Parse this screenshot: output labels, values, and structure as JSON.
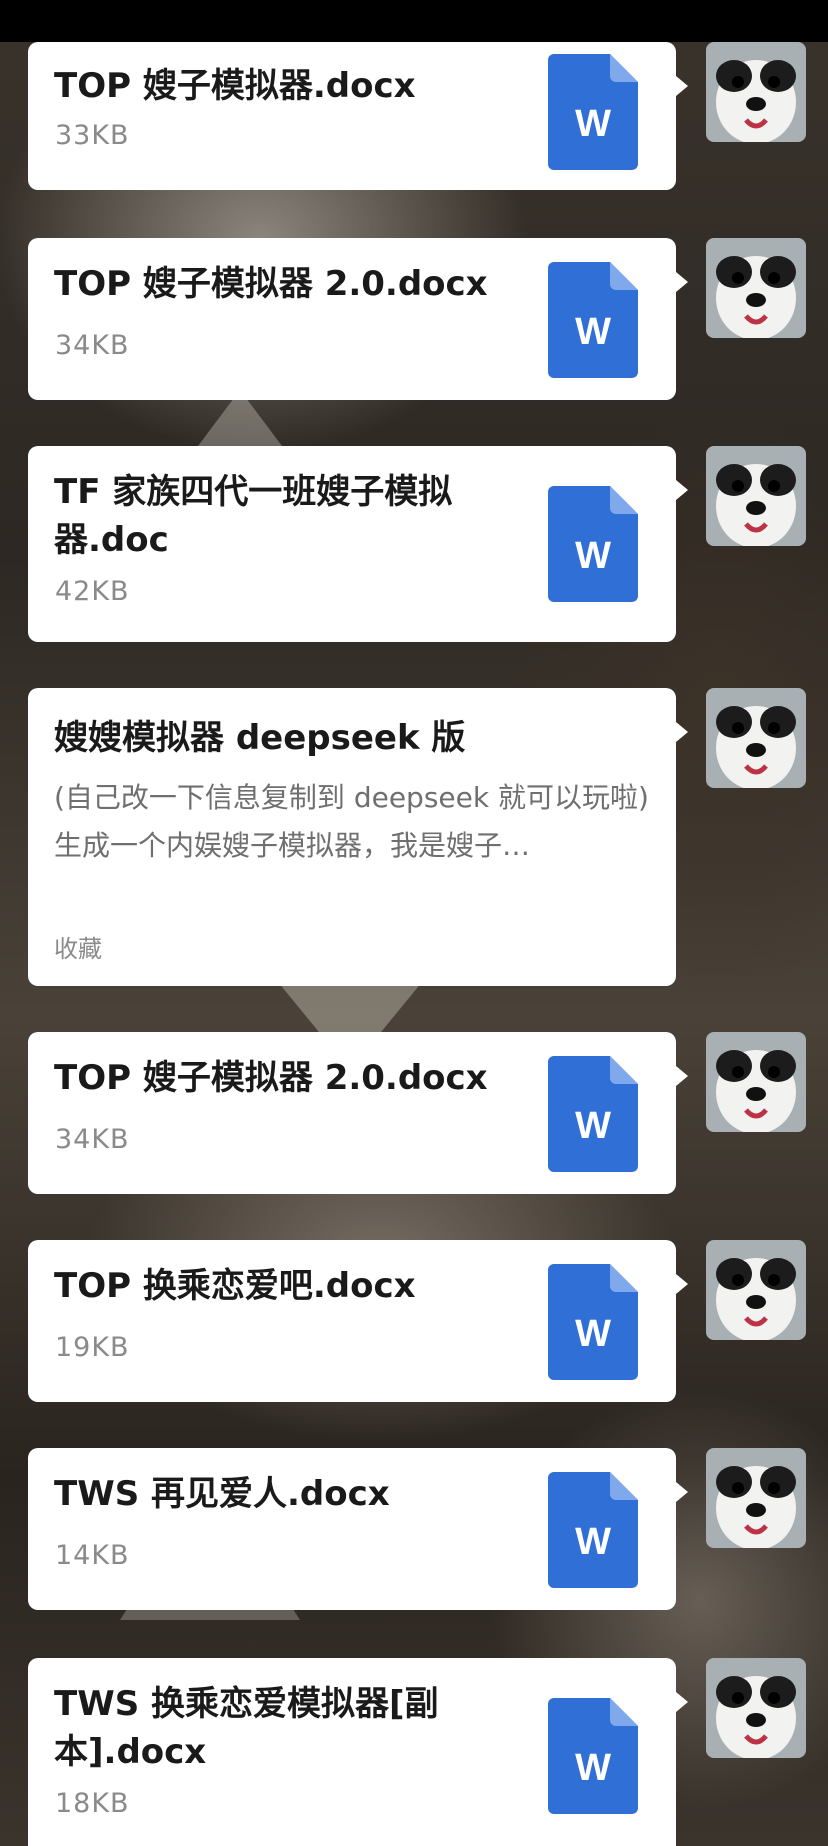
{
  "messages": [
    {
      "kind": "file",
      "name": "TOP 嫂子模拟器.docx",
      "size": "33KB",
      "icon": "word-doc-icon"
    },
    {
      "kind": "file",
      "name": "TOP 嫂子模拟器 2.0.docx",
      "size": "34KB",
      "icon": "word-doc-icon"
    },
    {
      "kind": "file",
      "name": "TF 家族四代一班嫂子模拟器.doc",
      "size": "42KB",
      "icon": "word-doc-icon"
    },
    {
      "kind": "note",
      "title": "嫂嫂模拟器 deepseek 版",
      "line1": "(自己改一下信息复制到 deepseek 就可以玩啦)",
      "line2": "生成一个内娱嫂子模拟器，我是嫂子…",
      "tag": "收藏"
    },
    {
      "kind": "file",
      "name": "TOP 嫂子模拟器 2.0.docx",
      "size": "34KB",
      "icon": "word-doc-icon"
    },
    {
      "kind": "file",
      "name": "TOP 换乘恋爱吧.docx",
      "size": "19KB",
      "icon": "word-doc-icon"
    },
    {
      "kind": "file",
      "name": "TWS 再见爱人.docx",
      "size": "14KB",
      "icon": "word-doc-icon"
    },
    {
      "kind": "file",
      "name": "TWS 换乘恋爱模拟器[副本].docx",
      "size": "18KB",
      "icon": "word-doc-icon"
    }
  ],
  "word_icon_letter": "W",
  "colors": {
    "word_blue": "#2f6fd6",
    "bubble": "#ffffff"
  }
}
